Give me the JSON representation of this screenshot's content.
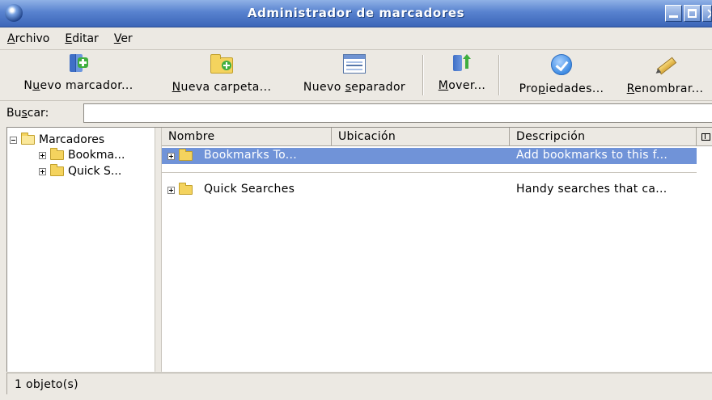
{
  "window": {
    "title": "Administrador de marcadores"
  },
  "menubar": {
    "items": [
      {
        "key": "A",
        "rest": "rchivo"
      },
      {
        "key": "E",
        "rest": "ditar"
      },
      {
        "key": "V",
        "rest": "er"
      }
    ]
  },
  "toolbar": {
    "new_bookmark": {
      "pre": "N",
      "key": "u",
      "post": "evo marcador...",
      "icon": "new-bookmark-icon"
    },
    "new_folder": {
      "pre": "",
      "key": "N",
      "post": "ueva carpeta...",
      "icon": "new-folder-icon"
    },
    "new_separator": {
      "pre": "Nuevo ",
      "key": "s",
      "post": "eparador",
      "icon": "new-separator-icon"
    },
    "move": {
      "pre": "",
      "key": "M",
      "post": "over...",
      "icon": "move-icon"
    },
    "properties": {
      "pre": "Pro",
      "key": "p",
      "post": "iedades...",
      "icon": "properties-check-icon"
    },
    "rename": {
      "pre": "",
      "key": "R",
      "post": "enombrar...",
      "icon": "rename-pencil-icon"
    }
  },
  "search": {
    "label_pre": "Bu",
    "label_key": "s",
    "label_post": "car:",
    "value": ""
  },
  "tree": {
    "root": {
      "label": "Marcadores",
      "expanded": true
    },
    "children": [
      {
        "label": "Bookma..."
      },
      {
        "label": "Quick S..."
      }
    ]
  },
  "list": {
    "columns": [
      "Nombre",
      "Ubicación",
      "Descripción"
    ],
    "rows": [
      {
        "name": "Bookmarks To...",
        "location": "",
        "description": "Add bookmarks to this f...",
        "selected": true
      },
      {
        "name": "Quick Searches",
        "location": "",
        "description": "Handy searches that ca...",
        "selected": false
      }
    ]
  },
  "status": {
    "text": "1 objeto(s)"
  },
  "colors": {
    "titlebar": "#5882cf",
    "selection": "#7093d8",
    "folder": "#f4d35e"
  }
}
